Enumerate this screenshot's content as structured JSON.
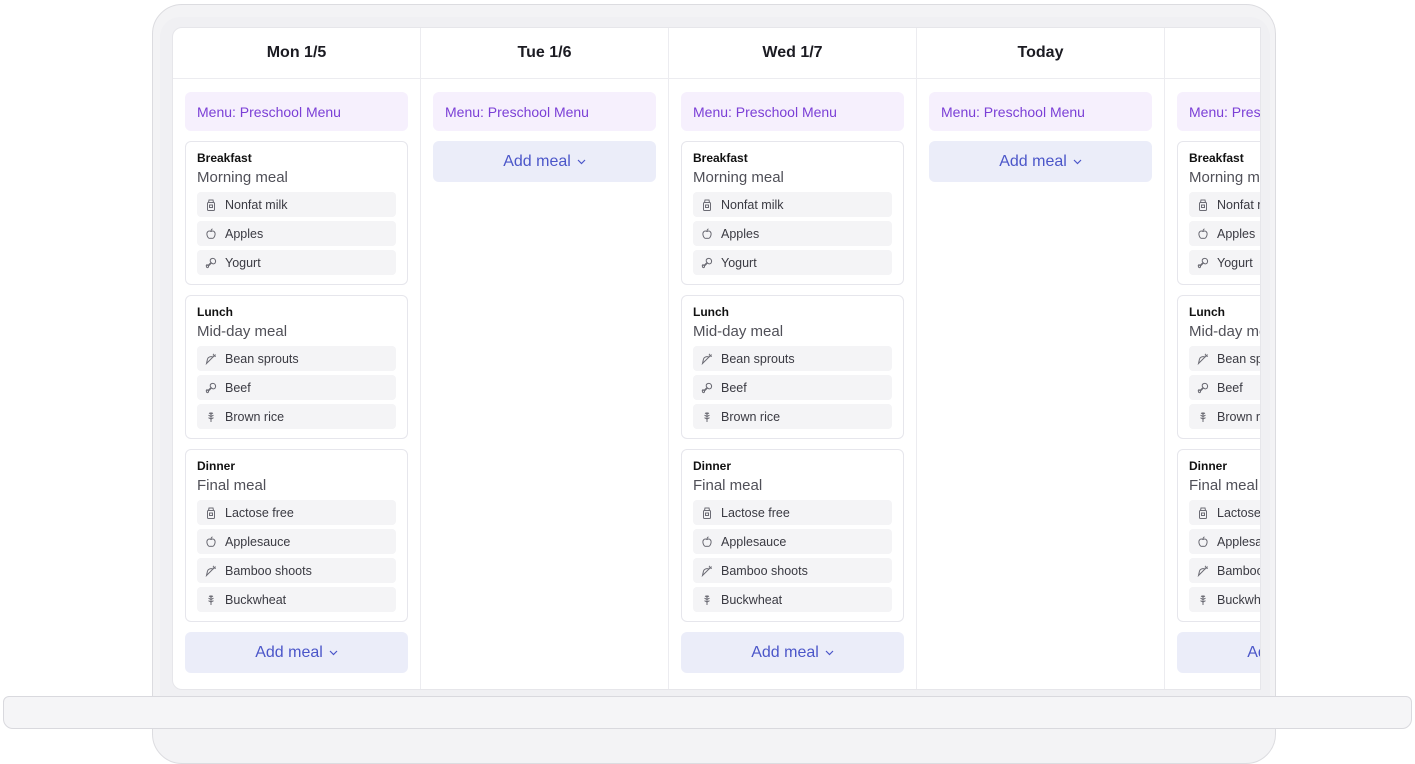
{
  "columns": [
    {
      "day": "Mon 1/5",
      "menu": "Menu: Preschool Menu",
      "meals": [
        {
          "type": "Breakfast",
          "desc": "Morning meal",
          "items": [
            {
              "name": "Nonfat milk",
              "icon": "milk-icon"
            },
            {
              "name": "Apples",
              "icon": "apple-icon"
            },
            {
              "name": "Yogurt",
              "icon": "drumstick-icon"
            }
          ]
        },
        {
          "type": "Lunch",
          "desc": "Mid-day meal",
          "items": [
            {
              "name": "Bean sprouts",
              "icon": "carrot-icon"
            },
            {
              "name": "Beef",
              "icon": "drumstick-icon"
            },
            {
              "name": "Brown rice",
              "icon": "wheat-icon"
            }
          ]
        },
        {
          "type": "Dinner",
          "desc": "Final meal",
          "items": [
            {
              "name": "Lactose free",
              "icon": "milk-icon"
            },
            {
              "name": "Applesauce",
              "icon": "apple-icon"
            },
            {
              "name": "Bamboo shoots",
              "icon": "carrot-icon"
            },
            {
              "name": "Buckwheat",
              "icon": "wheat-icon"
            }
          ]
        }
      ],
      "add_label": "Add meal"
    },
    {
      "day": "Tue 1/6",
      "menu": "Menu: Preschool Menu",
      "meals": [],
      "add_label": "Add meal"
    },
    {
      "day": "Wed 1/7",
      "menu": "Menu: Preschool Menu",
      "meals": [
        {
          "type": "Breakfast",
          "desc": "Morning meal",
          "items": [
            {
              "name": "Nonfat milk",
              "icon": "milk-icon"
            },
            {
              "name": "Apples",
              "icon": "apple-icon"
            },
            {
              "name": "Yogurt",
              "icon": "drumstick-icon"
            }
          ]
        },
        {
          "type": "Lunch",
          "desc": "Mid-day meal",
          "items": [
            {
              "name": "Bean sprouts",
              "icon": "carrot-icon"
            },
            {
              "name": "Beef",
              "icon": "drumstick-icon"
            },
            {
              "name": "Brown rice",
              "icon": "wheat-icon"
            }
          ]
        },
        {
          "type": "Dinner",
          "desc": "Final meal",
          "items": [
            {
              "name": "Lactose free",
              "icon": "milk-icon"
            },
            {
              "name": "Applesauce",
              "icon": "apple-icon"
            },
            {
              "name": "Bamboo shoots",
              "icon": "carrot-icon"
            },
            {
              "name": "Buckwheat",
              "icon": "wheat-icon"
            }
          ]
        }
      ],
      "add_label": "Add meal"
    },
    {
      "day": "Today",
      "menu": "Menu: Preschool Menu",
      "meals": [],
      "add_label": "Add meal"
    },
    {
      "day": "",
      "menu": "Menu: Preschool Menu",
      "meals": [
        {
          "type": "Breakfast",
          "desc": "Morning meal",
          "items": [
            {
              "name": "Nonfat milk",
              "icon": "milk-icon"
            },
            {
              "name": "Apples",
              "icon": "apple-icon"
            },
            {
              "name": "Yogurt",
              "icon": "drumstick-icon"
            }
          ]
        },
        {
          "type": "Lunch",
          "desc": "Mid-day meal",
          "items": [
            {
              "name": "Bean sprouts",
              "icon": "carrot-icon"
            },
            {
              "name": "Beef",
              "icon": "drumstick-icon"
            },
            {
              "name": "Brown rice",
              "icon": "wheat-icon"
            }
          ]
        },
        {
          "type": "Dinner",
          "desc": "Final meal",
          "items": [
            {
              "name": "Lactose free",
              "icon": "milk-icon"
            },
            {
              "name": "Applesauce",
              "icon": "apple-icon"
            },
            {
              "name": "Bamboo shoots",
              "icon": "carrot-icon"
            },
            {
              "name": "Buckwheat",
              "icon": "wheat-icon"
            }
          ]
        }
      ],
      "add_label": "Add meal"
    }
  ],
  "colors": {
    "menu_text": "#7b3fd6",
    "menu_bg": "#f6f0fd",
    "add_text": "#4b56c9",
    "add_bg": "#ebedf9"
  }
}
